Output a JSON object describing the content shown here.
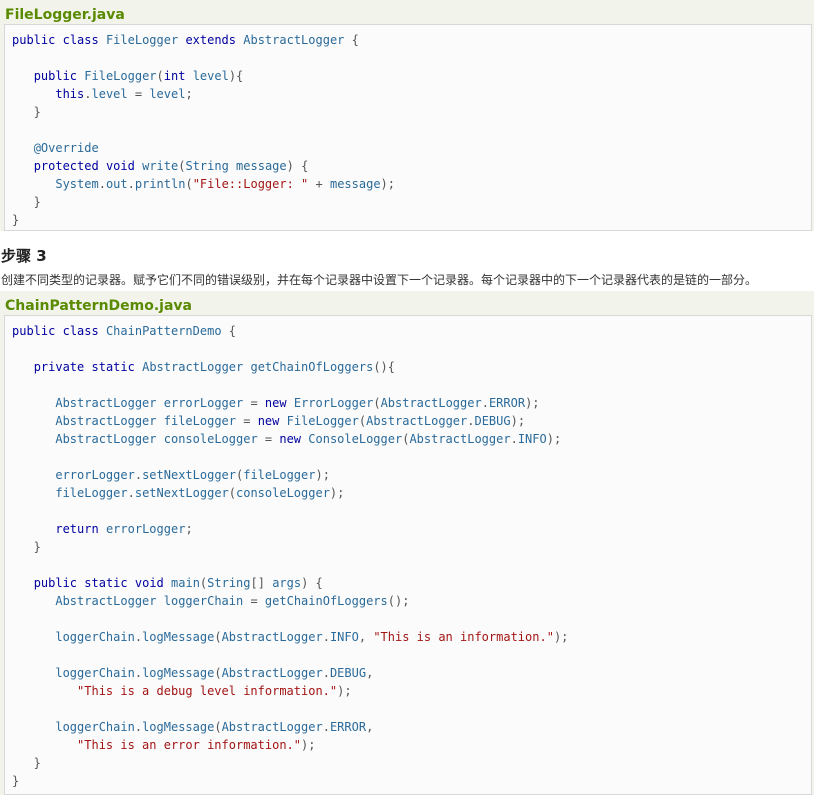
{
  "file1": {
    "name": "FileLogger.java",
    "lines": [
      "public class FileLogger extends AbstractLogger {",
      "",
      "   public FileLogger(int level){",
      "      this.level = level;",
      "   }",
      "",
      "   @Override",
      "   protected void write(String message) {",
      "      System.out.println(\"File::Logger: \" + message);",
      "   }",
      "}"
    ]
  },
  "step": {
    "title": "步骤 3",
    "description": "创建不同类型的记录器。赋予它们不同的错误级别，并在每个记录器中设置下一个记录器。每个记录器中的下一个记录器代表的是链的一部分。"
  },
  "file2": {
    "name": "ChainPatternDemo.java",
    "lines": [
      "public class ChainPatternDemo {",
      "",
      "   private static AbstractLogger getChainOfLoggers(){",
      "",
      "      AbstractLogger errorLogger = new ErrorLogger(AbstractLogger.ERROR);",
      "      AbstractLogger fileLogger = new FileLogger(AbstractLogger.DEBUG);",
      "      AbstractLogger consoleLogger = new ConsoleLogger(AbstractLogger.INFO);",
      "",
      "      errorLogger.setNextLogger(fileLogger);",
      "      fileLogger.setNextLogger(consoleLogger);",
      "",
      "      return errorLogger;",
      "   }",
      "",
      "   public static void main(String[] args) {",
      "      AbstractLogger loggerChain = getChainOfLoggers();",
      "",
      "      loggerChain.logMessage(AbstractLogger.INFO, \"This is an information.\");",
      "",
      "      loggerChain.logMessage(AbstractLogger.DEBUG,",
      "         \"This is a debug level information.\");",
      "",
      "      loggerChain.logMessage(AbstractLogger.ERROR,",
      "         \"This is an error information.\");",
      "   }",
      "}"
    ]
  }
}
